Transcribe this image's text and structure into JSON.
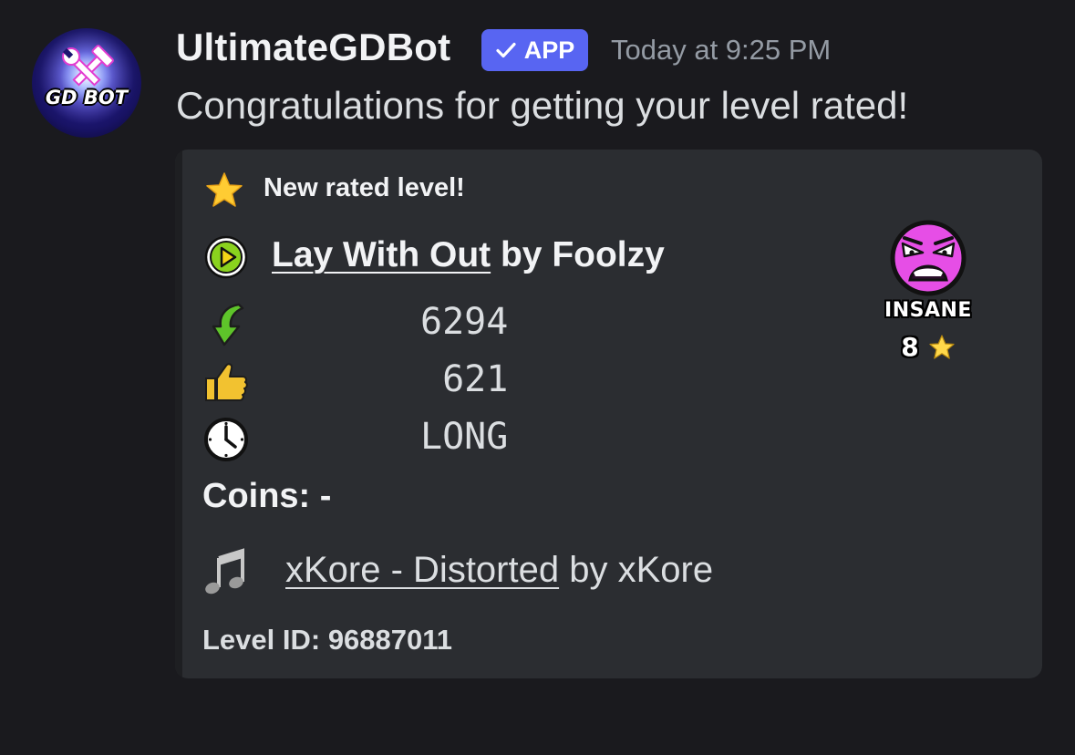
{
  "message": {
    "username": "UltimateGDBot",
    "badge": "APP",
    "timestamp": "Today at 9:25 PM",
    "content": "Congratulations for getting your level rated!",
    "avatar_text": "GD BOT",
    "avatar_icon": "hammer-wrench-icon"
  },
  "embed": {
    "author": "New rated level!",
    "author_icon": "star-emoji",
    "title_icon": "play-button-emoji",
    "level_name": "Lay With Out",
    "by_text": " by Foolzy",
    "stats": [
      {
        "icon": "download-arrow-icon",
        "value": "6294"
      },
      {
        "icon": "thumbs-up-icon",
        "value": " 621"
      },
      {
        "icon": "clock-icon",
        "value": "LONG"
      }
    ],
    "coins": "Coins: -",
    "song_icon": "music-notes-emoji",
    "song_name": "xKore - Distorted",
    "song_by": " by xKore",
    "footer": "Level ID: 96887011",
    "difficulty": {
      "icon": "insane-face-icon",
      "name": "Insane",
      "stars": "8",
      "star_icon": "star-icon"
    }
  },
  "colors": {
    "background": "#1a1a1e",
    "embed_background": "#2b2d31",
    "badge": "#5865f2",
    "timestamp": "#949ba4",
    "insane_face": "#e64ee6"
  }
}
